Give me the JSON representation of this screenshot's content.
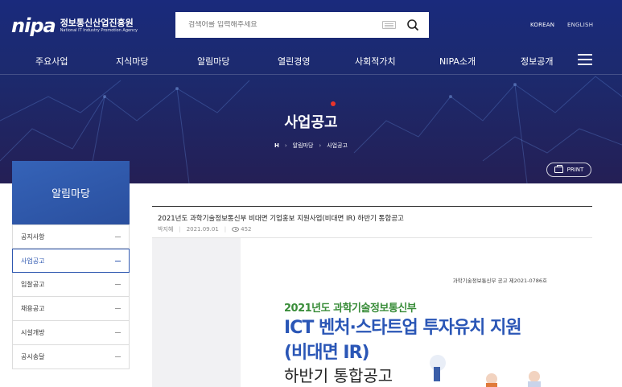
{
  "header": {
    "logo_mark": "nipa",
    "logo_ko": "정보통신산업진흥원",
    "logo_en": "National IT Industry Promotion Agency",
    "search_placeholder": "검색어를 입력해주세요",
    "lang_ko": "KOREAN",
    "lang_en": "ENGLISH"
  },
  "gnb": {
    "items": [
      "주요사업",
      "지식마당",
      "알림마당",
      "열린경영",
      "사회적가치",
      "NIPA소개",
      "정보공개"
    ]
  },
  "hero": {
    "title": "사업공고",
    "breadcrumb": [
      "H",
      "알림마당",
      "사업공고"
    ],
    "print_label": "PRINT"
  },
  "sidebar": {
    "heading": "알림마당",
    "items": [
      {
        "label": "공지사항",
        "active": false
      },
      {
        "label": "사업공고",
        "active": true
      },
      {
        "label": "입찰공고",
        "active": false
      },
      {
        "label": "채용공고",
        "active": false
      },
      {
        "label": "시설개방",
        "active": false
      },
      {
        "label": "공시송달",
        "active": false
      }
    ]
  },
  "post": {
    "title": "2021년도 과학기술정보통신부 비대면 기업홍보 지원사업(비대면 IR) 하반기 통합공고",
    "author": "박지혜",
    "date": "2021.09.01",
    "views": "452"
  },
  "poster": {
    "doc_no": "과학기술정보통신부 공고 제2021-0786호",
    "year_line": "2021년도 과학기술정보통신부",
    "main_line": "ICT 벤처·스타트업 투자유치 지원",
    "ir_line": "(비대면 IR)",
    "sub_line": "하반기 통합공고"
  },
  "colors": {
    "hero_bg": "#1c2a6e",
    "accent_red": "#e8342b",
    "side_blue": "#2f58b0",
    "poster_green": "#3a8d3a",
    "poster_blue": "#2a56b6"
  }
}
